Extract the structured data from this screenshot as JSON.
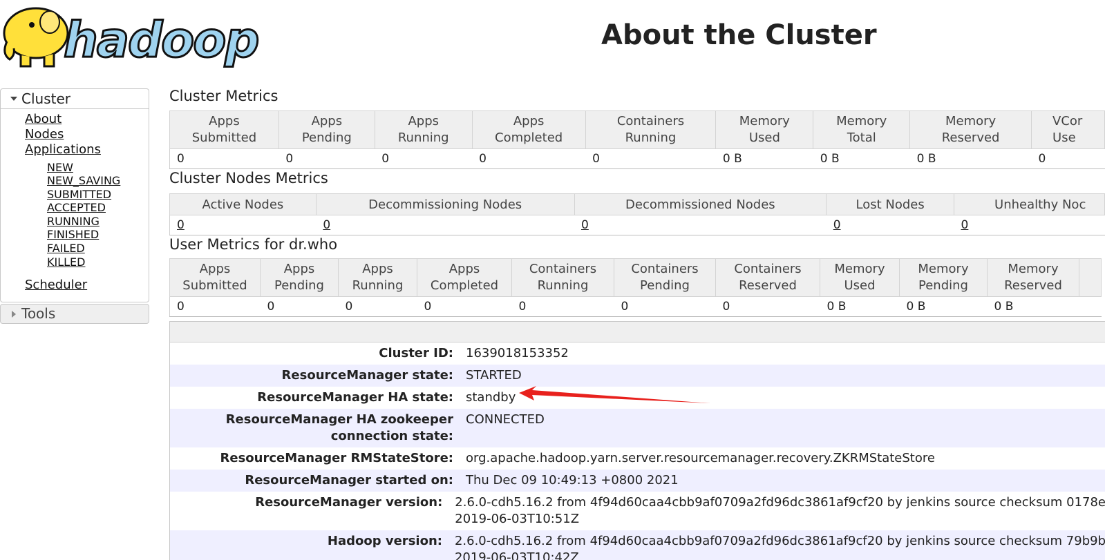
{
  "logo_text": "hadoop",
  "page_title": "About the Cluster",
  "sidebar": {
    "cluster_label": "Cluster",
    "links": [
      "About",
      "Nodes",
      "Applications"
    ],
    "app_states": [
      "NEW",
      "NEW_SAVING",
      "SUBMITTED",
      "ACCEPTED",
      "RUNNING",
      "FINISHED",
      "FAILED",
      "KILLED"
    ],
    "scheduler": "Scheduler",
    "tools_label": "Tools"
  },
  "cluster_metrics": {
    "title": "Cluster Metrics",
    "headers": [
      [
        "Apps",
        "Submitted"
      ],
      [
        "Apps",
        "Pending"
      ],
      [
        "Apps",
        "Running"
      ],
      [
        "Apps",
        "Completed"
      ],
      [
        "Containers",
        "Running"
      ],
      [
        "Memory",
        "Used"
      ],
      [
        "Memory",
        "Total"
      ],
      [
        "Memory",
        "Reserved"
      ],
      [
        "VCor",
        "Use"
      ]
    ],
    "values": [
      "0",
      "0",
      "0",
      "0",
      "0",
      "0 B",
      "0 B",
      "0 B",
      "0"
    ]
  },
  "nodes_metrics": {
    "title": "Cluster Nodes Metrics",
    "headers": [
      "Active Nodes",
      "Decommissioning Nodes",
      "Decommissioned Nodes",
      "Lost Nodes",
      "Unhealthy Noc"
    ],
    "values": [
      "0",
      "0",
      "0",
      "0",
      "0"
    ]
  },
  "user_metrics": {
    "title": "User Metrics for dr.who",
    "headers": [
      [
        "Apps",
        "Submitted"
      ],
      [
        "Apps",
        "Pending"
      ],
      [
        "Apps",
        "Running"
      ],
      [
        "Apps",
        "Completed"
      ],
      [
        "Containers",
        "Running"
      ],
      [
        "Containers",
        "Pending"
      ],
      [
        "Containers",
        "Reserved"
      ],
      [
        "Memory",
        "Used"
      ],
      [
        "Memory",
        "Pending"
      ],
      [
        "Memory",
        "Reserved"
      ]
    ],
    "values": [
      "0",
      "0",
      "0",
      "0",
      "0",
      "0",
      "0",
      "0 B",
      "0 B",
      "0 B"
    ]
  },
  "cluster_info": [
    {
      "key": "Cluster ID:",
      "value": "1639018153352"
    },
    {
      "key": "ResourceManager state:",
      "value": "STARTED"
    },
    {
      "key": "ResourceManager HA state:",
      "value": "standby"
    },
    {
      "key": "ResourceManager HA zookeeper\nconnection state:",
      "value": "CONNECTED"
    },
    {
      "key": "ResourceManager RMStateStore:",
      "value": "org.apache.hadoop.yarn.server.resourcemanager.recovery.ZKRMStateStore"
    },
    {
      "key": "ResourceManager started on:",
      "value": "Thu Dec 09 10:49:13 +0800 2021"
    },
    {
      "key": "ResourceManager version:",
      "value": "2.6.0-cdh5.16.2 from 4f94d60caa4cbb9af0709a2fd96dc3861af9cf20 by jenkins source checksum 0178e\n2019-06-03T10:51Z"
    },
    {
      "key": "Hadoop version:",
      "value": "2.6.0-cdh5.16.2 from 4f94d60caa4cbb9af0709a2fd96dc3861af9cf20 by jenkins source checksum 79b9b\n2019-06-03T10:42Z"
    }
  ],
  "colors": {
    "accent_arrow": "#e8211d",
    "logo_blue": "#9fd3ef",
    "logo_yellow": "#ffe03a"
  }
}
